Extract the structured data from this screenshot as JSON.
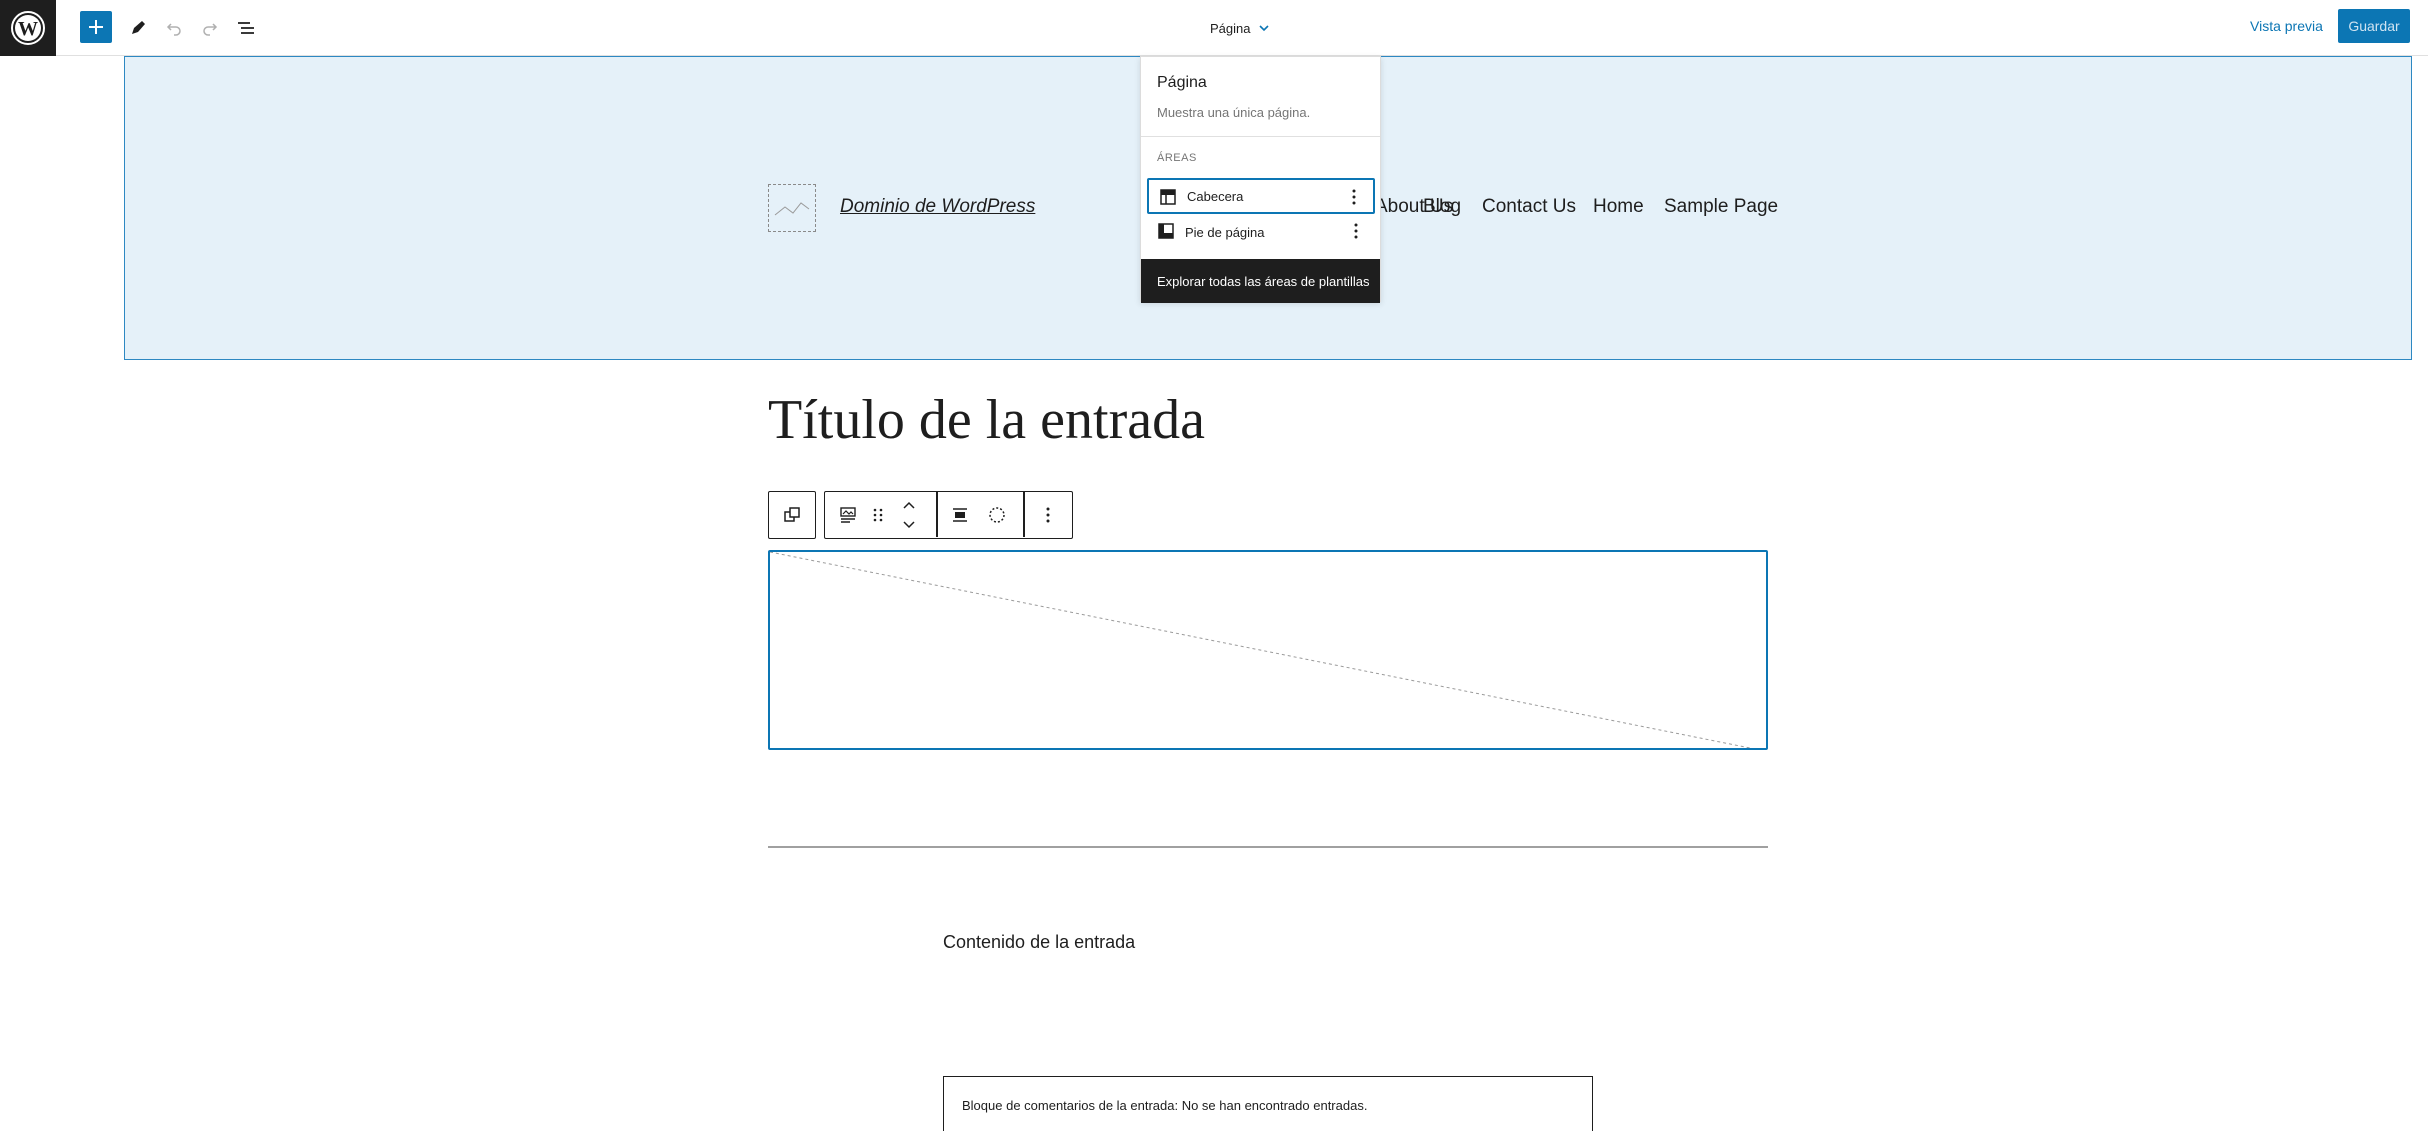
{
  "toolbar": {
    "template_name": "Página",
    "preview_label": "Vista previa",
    "save_label": "Guardar"
  },
  "header": {
    "site_title": "Dominio de WordPress",
    "nav": [
      "About Us",
      "Blog",
      "Contact Us",
      "Home",
      "Sample Page"
    ]
  },
  "popover": {
    "title": "Página",
    "description": "Muestra una única página.",
    "section_label": "ÁREAS",
    "items": [
      {
        "label": "Cabecera",
        "icon": "header-layout-icon"
      },
      {
        "label": "Pie de página",
        "icon": "footer-layout-icon"
      }
    ],
    "explore_label": "Explorar todas las áreas de plantillas"
  },
  "content": {
    "post_title": "Título de la entrada",
    "post_content": "Contenido de la entrada",
    "comments_text": "Bloque de comentarios de la entrada: No se han encontrado entradas."
  },
  "colors": {
    "accent": "#0c76b4",
    "header_bg": "#e5f1f9",
    "dark": "#1e1e1e"
  }
}
